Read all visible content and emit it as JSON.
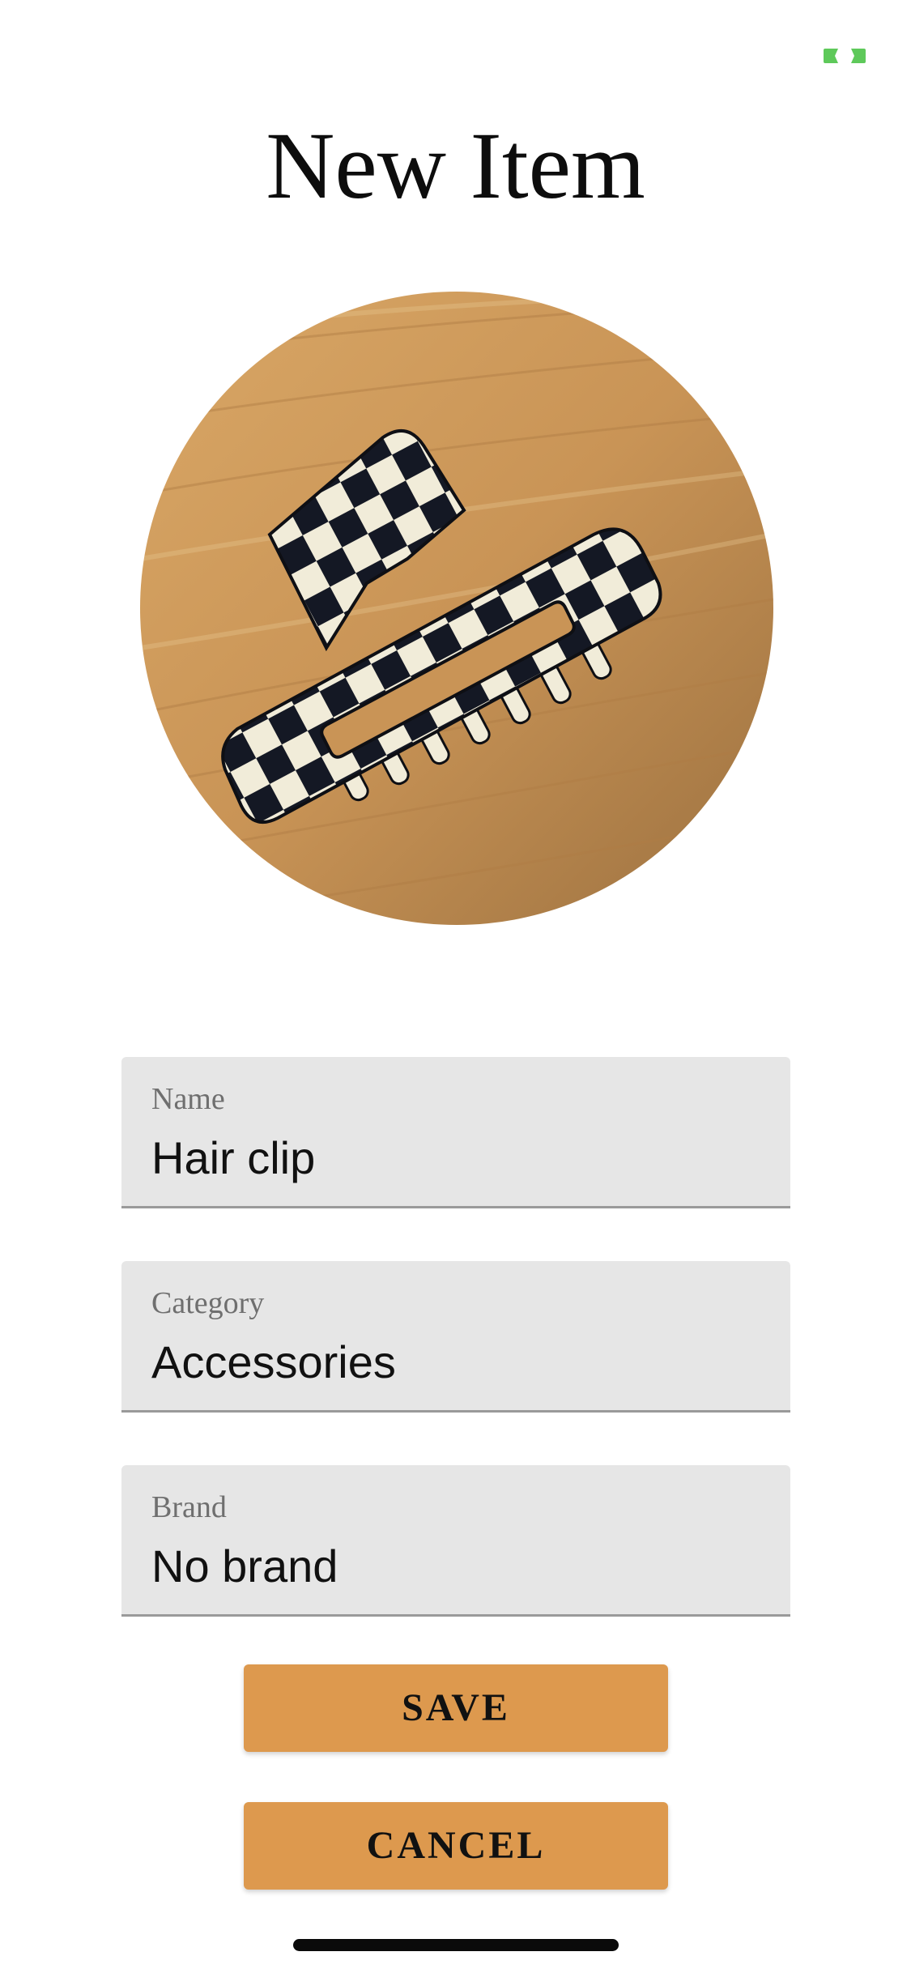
{
  "screen": {
    "title": "New Item"
  },
  "status": {
    "indicator_icon": "camera-active-icon",
    "indicator_color": "#5ec95a"
  },
  "photo": {
    "icon": "item-photo",
    "subject": "checkered hair clip on wooden table"
  },
  "form": {
    "name": {
      "label": "Name",
      "value": "Hair clip"
    },
    "category": {
      "label": "Category",
      "value": "Accessories"
    },
    "brand": {
      "label": "Brand",
      "value": "No brand"
    }
  },
  "actions": {
    "save_label": "SAVE",
    "cancel_label": "CANCEL",
    "button_color": "#dd994e"
  }
}
